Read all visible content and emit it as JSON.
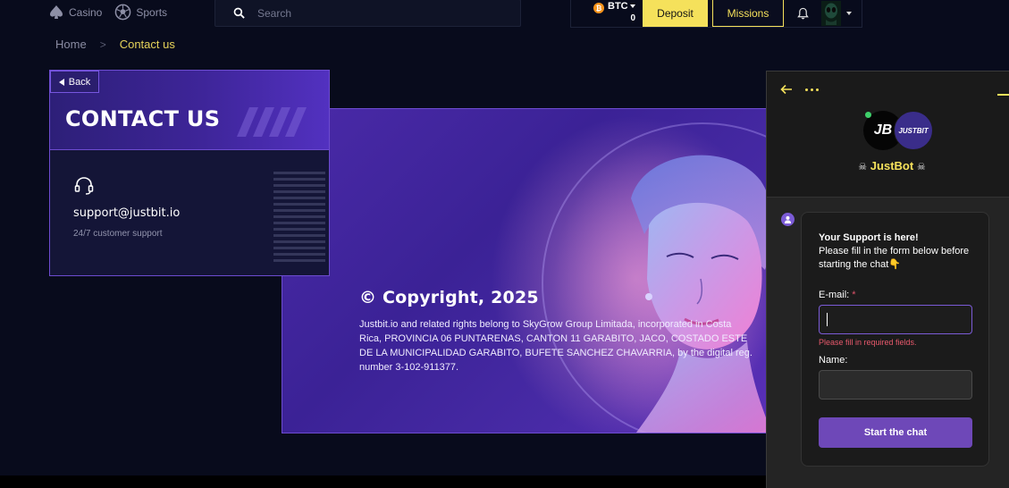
{
  "nav": {
    "casino_label": "Casino",
    "sports_label": "Sports"
  },
  "search": {
    "placeholder": "Search"
  },
  "account": {
    "currency": "BTC",
    "currency_icon": "bitcoin-icon",
    "balance": "0",
    "deposit_label": "Deposit",
    "missions_label": "Missions"
  },
  "breadcrumb": {
    "home": "Home",
    "separator": ">",
    "current": "Contact us"
  },
  "contact_card": {
    "back_label": "Back",
    "title": "CONTACT US",
    "email": "support@justbit.io",
    "subtitle": "24/7 customer support"
  },
  "banner": {
    "copyright_title": "© Copyright, 2025",
    "copyright_text": "Justbit.io and related rights belong to SkyGrow Group Limitada, incorporated in Costa Rica, PROVINCIA 06 PUNTARENAS, CANTON 11 GARABITO, JACO, COSTADO ESTE DE LA MUNICIPALIDAD GARABITO, BUFETE SANCHEZ CHAVARRIA, by the digital reg. number 3-102-911377."
  },
  "chat": {
    "bot_name": "JustBot",
    "avatar_primary": "JB",
    "avatar_secondary": "JUSTBIT",
    "message_title": "Your Support is here!",
    "message_body": "Please fill in the form below before starting the chat👇",
    "email_label": "E-mail:",
    "required_mark": "*",
    "error_text": "Please fill in required fields.",
    "name_label": "Name:",
    "start_label": "Start the chat"
  },
  "colors": {
    "accent_yellow": "#f5e15b",
    "accent_purple": "#6d4ccf",
    "background": "#080b1c",
    "error": "#e8596c"
  }
}
